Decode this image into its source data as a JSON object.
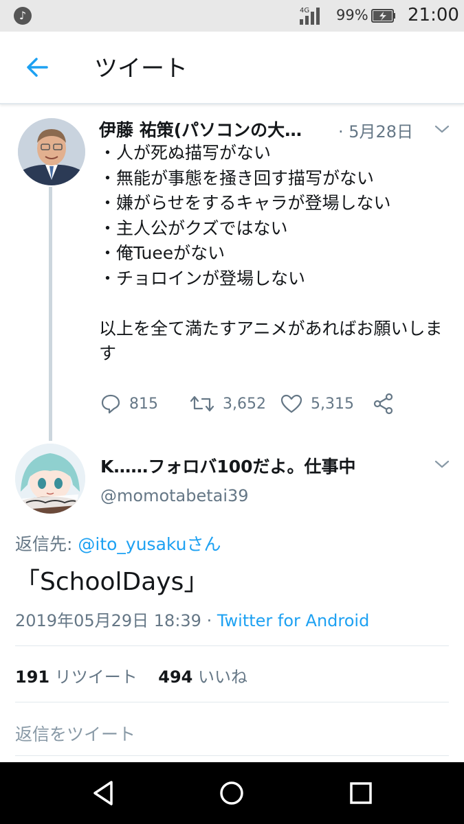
{
  "status_bar": {
    "network": "4G",
    "battery_percent": "99%",
    "time": "21:00"
  },
  "app_bar": {
    "title": "ツイート"
  },
  "parent_tweet": {
    "author_name": "伊藤 祐策(パソコンの大…",
    "date": "· 5月28日",
    "body": "・人が死ぬ描写がない\n・無能が事態を掻き回す描写がない\n・嫌がらせをするキャラが登場しない\n・主人公がクズではない\n・俺Tueeがない\n・チョロインが登場しない\n\n以上を全て満たすアニメがあればお願いします",
    "replies": "815",
    "retweets": "3,652",
    "likes": "5,315"
  },
  "main_tweet": {
    "author_name": "K……フォロバ100だよ。仕事中",
    "handle": "@momotabetai39",
    "reply_prefix": "返信先: ",
    "reply_user": "@ito_yusaku",
    "reply_suffix": "さん",
    "text": "「SchoolDays」",
    "timestamp": "2019年05月29日 18:39 · ",
    "source": "Twitter for Android",
    "retweet_count": "191",
    "retweet_label": " リツイート",
    "like_count": "494",
    "like_label": " いいね"
  },
  "reply_placeholder": "返信をツイート",
  "colors": {
    "accent": "#1da1f2",
    "secondary_text": "#657786",
    "divider": "#e1e8ed"
  }
}
